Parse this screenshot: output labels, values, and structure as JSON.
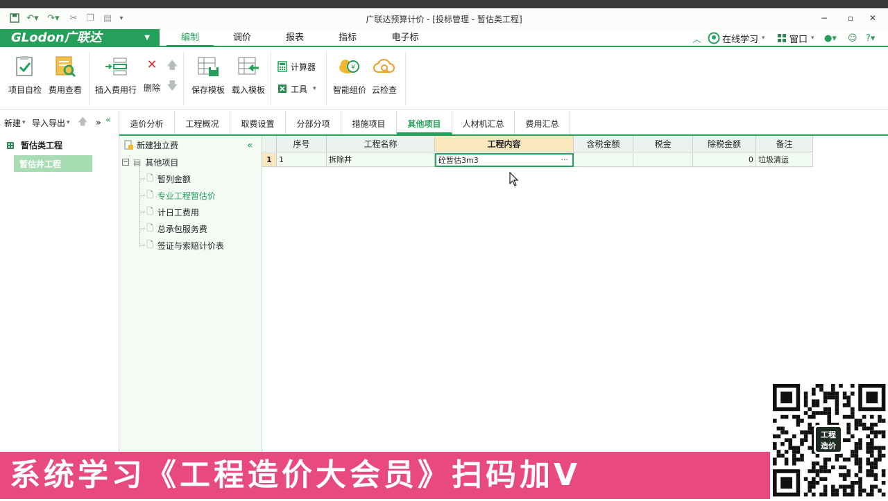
{
  "window": {
    "title": "广联达预算计价 - [投标管理 - 暂估类工程]",
    "minimize": "−",
    "restore": "▫",
    "close": "✕"
  },
  "quick_access": [
    "save-icon",
    "undo-icon",
    "redo-icon",
    "cut-icon",
    "copy-icon",
    "paste-icon",
    "customize-icon"
  ],
  "menubar": {
    "logo": "GLodon广联达",
    "tabs": [
      "编制",
      "调价",
      "报表",
      "指标",
      "电子标"
    ],
    "active_tab": "编制",
    "online_learning": "在线学习",
    "window_menu": "窗口"
  },
  "ribbon": {
    "buttons": [
      {
        "label": "项目自检",
        "icon": "project-check-icon"
      },
      {
        "label": "费用查看",
        "icon": "cost-view-icon"
      },
      {
        "label": "插入费用行",
        "icon": "insert-row-icon"
      },
      {
        "label": "删除",
        "icon": "delete-icon"
      },
      {
        "label": "保存模板",
        "icon": "save-template-icon"
      },
      {
        "label": "载入模板",
        "icon": "load-template-icon"
      },
      {
        "label": "智能组价",
        "icon": "smart-price-icon"
      },
      {
        "label": "云检查",
        "icon": "cloud-check-icon"
      }
    ],
    "calculator": "计算器",
    "tools": "工具"
  },
  "left_panel": {
    "new": "新建",
    "import_export": "导入导出",
    "root": "暂估类工程",
    "child": "暂估井工程"
  },
  "page_tabs": [
    "造价分析",
    "工程概况",
    "取费设置",
    "分部分项",
    "措施项目",
    "其他项目",
    "人材机汇总",
    "费用汇总"
  ],
  "active_page_tab": "其他项目",
  "tree": {
    "new_standalone": "新建独立费",
    "root": "其他项目",
    "children": [
      "暂列金额",
      "专业工程暂估价",
      "计日工费用",
      "总承包服务费",
      "签证与索赔计价表"
    ],
    "selected": "专业工程暂估价"
  },
  "grid": {
    "columns": [
      "序号",
      "工程名称",
      "工程内容",
      "含税金额",
      "税金",
      "除税金额",
      "备注"
    ],
    "selected_column": "工程内容",
    "rows": [
      {
        "row_num": "1",
        "seq": "1",
        "name": "拆除井",
        "content": "砼暂估3m3",
        "tax_incl": "",
        "tax": "",
        "tax_excl": "0",
        "remark": "垃圾清运"
      }
    ]
  },
  "banner": {
    "text": "系统学习《工程造价大会员》扫码加V"
  },
  "qr": {
    "badge": "工程造价"
  },
  "colors": {
    "accent": "#24a05a",
    "banner": "#e94a7d",
    "header_selected": "#fbe7bd"
  }
}
